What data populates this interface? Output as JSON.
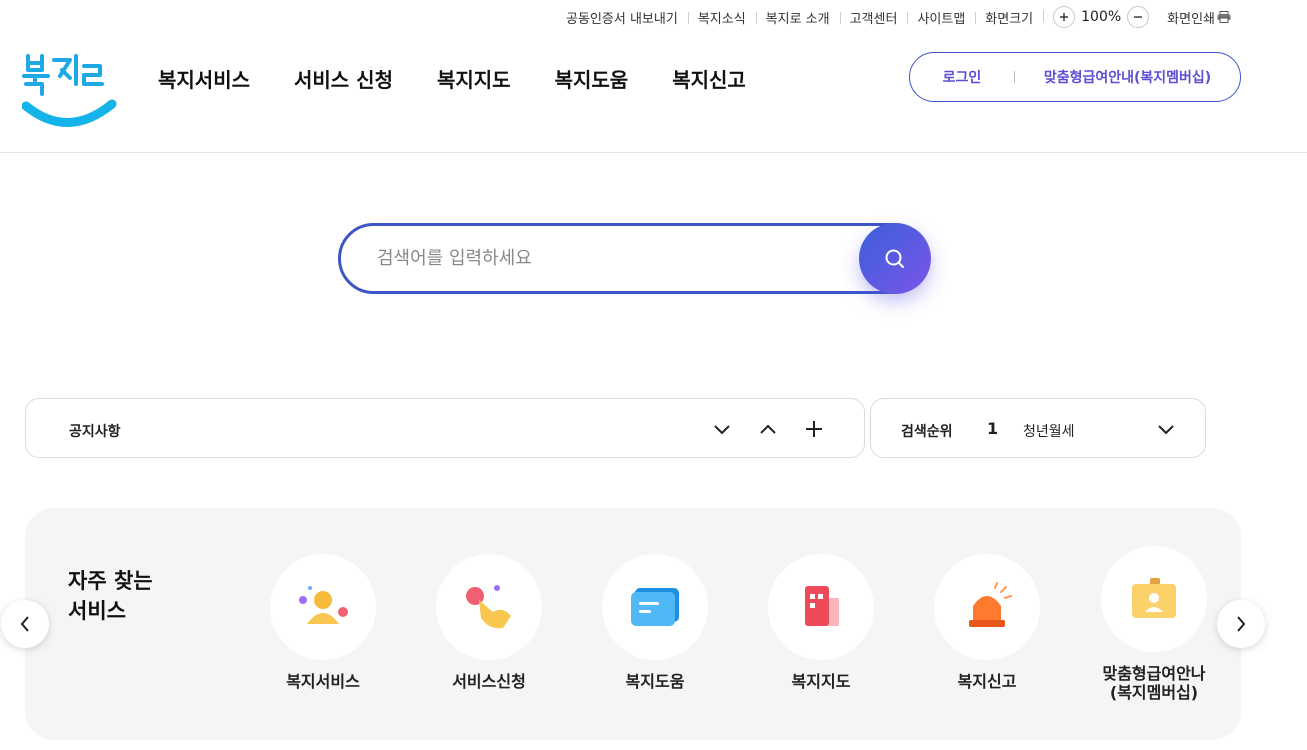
{
  "utility": {
    "cert_export": "공동인증서 내보내기",
    "news": "복지소식",
    "about": "복지로 소개",
    "customer_center": "고객센터",
    "sitemap": "사이트맵",
    "screen_size": "화면크기",
    "zoom_value": "100%",
    "print": "화면인쇄"
  },
  "logo": {
    "text": "복지로"
  },
  "gnb": {
    "items": [
      {
        "label": "복지서비스"
      },
      {
        "label": "서비스 신청"
      },
      {
        "label": "복지지도"
      },
      {
        "label": "복지도움"
      },
      {
        "label": "복지신고"
      }
    ]
  },
  "account": {
    "login": "로그인",
    "membership": "맞춤형급여안내(복지멤버십)"
  },
  "search": {
    "placeholder": "검색어를 입력하세요"
  },
  "notice": {
    "label": "공지사항"
  },
  "ranking": {
    "label": "검색순위",
    "rank": "1",
    "keyword": "청년월세"
  },
  "frequent": {
    "title_line1": "자주 찾는",
    "title_line2": "서비스",
    "items": [
      {
        "label": "복지서비스",
        "icon": "person-icon"
      },
      {
        "label": "서비스신청",
        "icon": "tap-hand-icon"
      },
      {
        "label": "복지도움",
        "icon": "chat-icon"
      },
      {
        "label": "복지지도",
        "icon": "building-icon"
      },
      {
        "label": "복지신고",
        "icon": "siren-icon"
      },
      {
        "label": "맞춤형급여안나\n(복지멤버십)",
        "label_line1": "맞춤형급여안나",
        "label_line2": "(복지멤버십)",
        "icon": "id-card-icon"
      }
    ]
  },
  "colors": {
    "primary": "#3f56c9",
    "accent": "#5b4fd6",
    "logo_blue": "#1fa8e6"
  }
}
